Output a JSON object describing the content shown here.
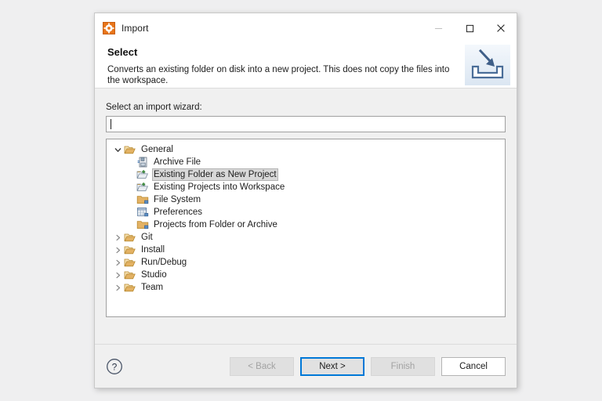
{
  "window": {
    "title": "Import",
    "icon": "gear-icon",
    "controls": {
      "minimize": "minimize-icon",
      "maximize": "maximize-icon",
      "close": "close-icon"
    }
  },
  "header": {
    "title": "Select",
    "description": "Converts an existing folder on disk into a new project. This does not copy the files into the workspace.",
    "banner_icon": "import-tray-icon"
  },
  "body": {
    "filter_label": "Select an import wizard:",
    "filter_value": "",
    "filter_placeholder": "",
    "tree": [
      {
        "label": "General",
        "icon": "open-folder-icon",
        "level": 0,
        "expanded": true,
        "hasChildren": true,
        "selected": false
      },
      {
        "label": "Archive File",
        "icon": "archive-file-icon",
        "level": 1,
        "expanded": false,
        "hasChildren": false,
        "selected": false
      },
      {
        "label": "Existing Folder as New Project",
        "icon": "folder-new-project-icon",
        "level": 1,
        "expanded": false,
        "hasChildren": false,
        "selected": true
      },
      {
        "label": "Existing Projects into Workspace",
        "icon": "folder-new-project-icon",
        "level": 1,
        "expanded": false,
        "hasChildren": false,
        "selected": false
      },
      {
        "label": "File System",
        "icon": "folder-icon",
        "level": 1,
        "expanded": false,
        "hasChildren": false,
        "selected": false
      },
      {
        "label": "Preferences",
        "icon": "preferences-grid-icon",
        "level": 1,
        "expanded": false,
        "hasChildren": false,
        "selected": false
      },
      {
        "label": "Projects from Folder or Archive",
        "icon": "folder-icon",
        "level": 1,
        "expanded": false,
        "hasChildren": false,
        "selected": false
      },
      {
        "label": "Git",
        "icon": "open-folder-icon",
        "level": 0,
        "expanded": false,
        "hasChildren": true,
        "selected": false
      },
      {
        "label": "Install",
        "icon": "open-folder-icon",
        "level": 0,
        "expanded": false,
        "hasChildren": true,
        "selected": false
      },
      {
        "label": "Run/Debug",
        "icon": "open-folder-icon",
        "level": 0,
        "expanded": false,
        "hasChildren": true,
        "selected": false
      },
      {
        "label": "Studio",
        "icon": "open-folder-icon",
        "level": 0,
        "expanded": false,
        "hasChildren": true,
        "selected": false
      },
      {
        "label": "Team",
        "icon": "open-folder-icon",
        "level": 0,
        "expanded": false,
        "hasChildren": true,
        "selected": false
      }
    ]
  },
  "footer": {
    "help_icon": "help-question-icon",
    "buttons": [
      {
        "label": "< Back",
        "name": "back-button",
        "state": "disabled"
      },
      {
        "label": "Next >",
        "name": "next-button",
        "state": "default"
      },
      {
        "label": "Finish",
        "name": "finish-button",
        "state": "disabled"
      },
      {
        "label": "Cancel",
        "name": "cancel-button",
        "state": "plain"
      }
    ]
  },
  "colors": {
    "accent": "#0078d7",
    "brand_orange": "#e8751a",
    "folder_gold": "#e8b563",
    "page_bg": "#efeff0",
    "dialog_bg": "#f0f0f0"
  }
}
